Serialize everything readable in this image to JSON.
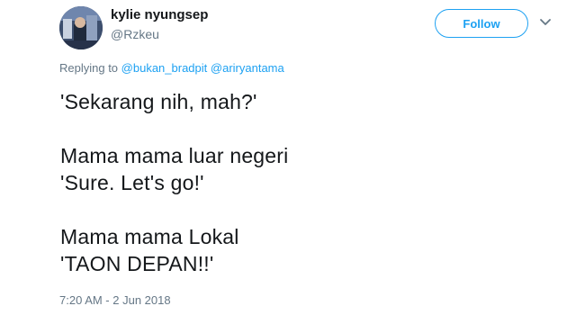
{
  "author": {
    "display_name": "kylie nyungsep",
    "handle": "@Rzkeu"
  },
  "follow_button": {
    "label": "Follow",
    "color": "#1da1f2"
  },
  "menu": {
    "icon": "chevron-down-icon"
  },
  "reply": {
    "prefix": "Replying to",
    "mentions": [
      "@bukan_bradpit",
      "@ariryantama"
    ]
  },
  "tweet": {
    "lines": [
      "'Sekarang nih, mah?'",
      "",
      "Mama mama luar negeri",
      "'Sure. Let's go!'",
      "",
      "Mama mama Lokal",
      "'TAON DEPAN!!'"
    ]
  },
  "timestamp": "7:20 AM - 2 Jun 2018",
  "colors": {
    "text": "#14171a",
    "secondary": "#657786",
    "link": "#1da1f2"
  }
}
